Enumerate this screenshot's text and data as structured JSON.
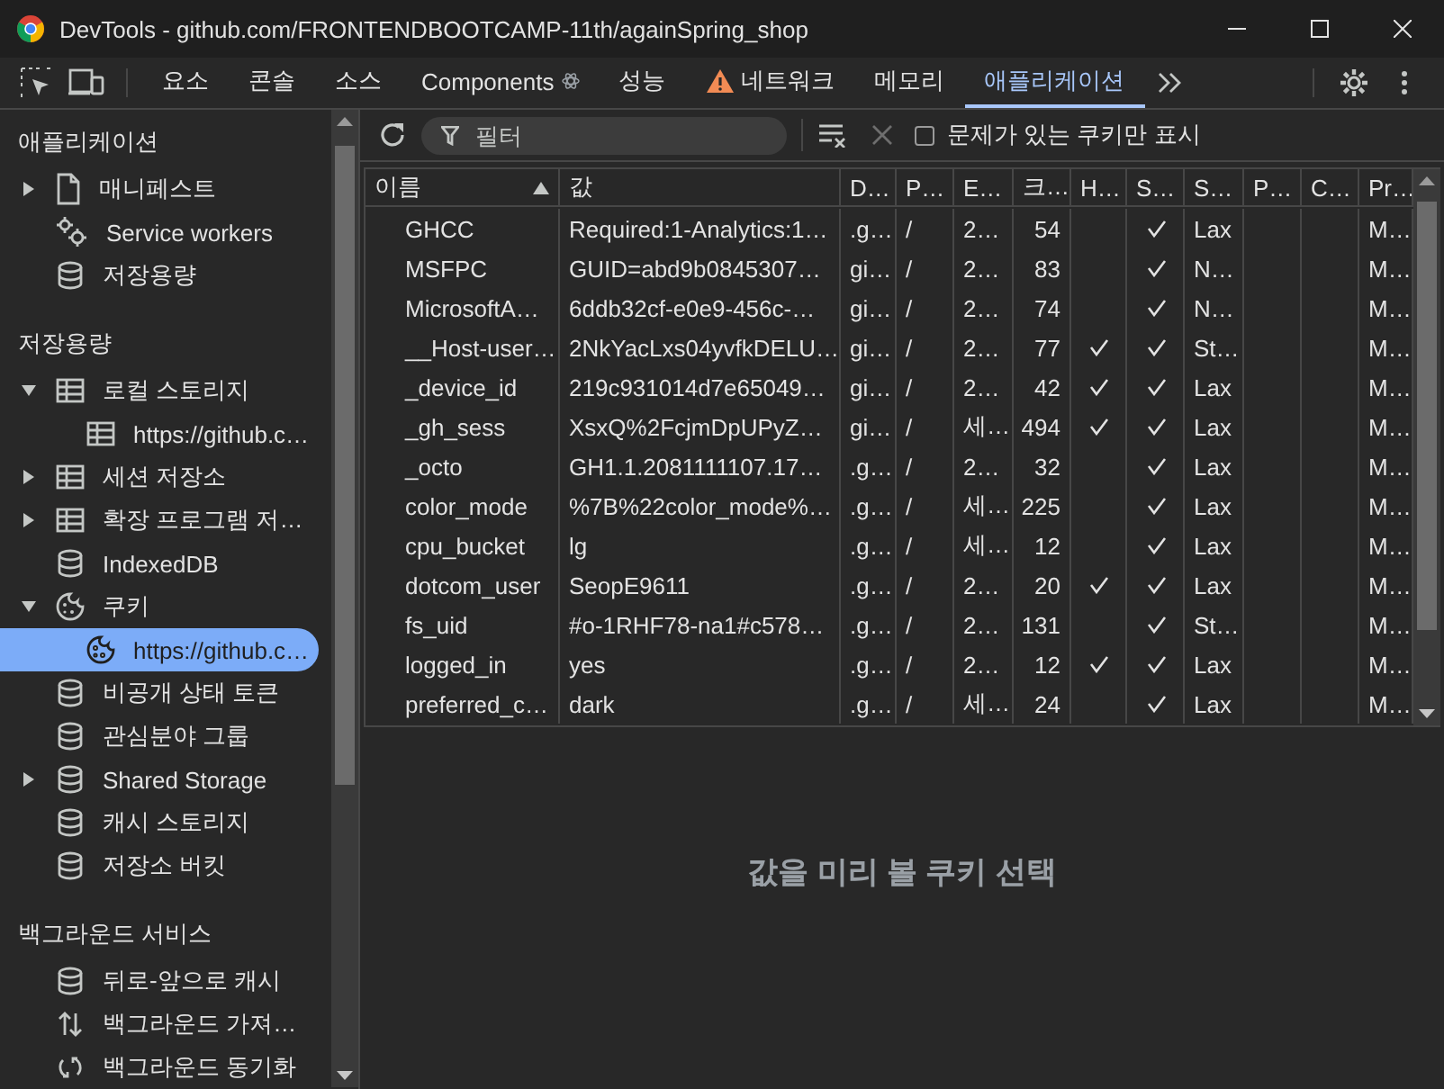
{
  "window": {
    "title": "DevTools - github.com/FRONTENDBOOTCAMP-11th/againSpring_shop"
  },
  "tabs": [
    {
      "label": "요소",
      "selected": false,
      "kind": "plain"
    },
    {
      "label": "콘솔",
      "selected": false,
      "kind": "plain"
    },
    {
      "label": "소스",
      "selected": false,
      "kind": "plain"
    },
    {
      "label": "Components",
      "selected": false,
      "kind": "extension"
    },
    {
      "label": "성능",
      "selected": false,
      "kind": "plain"
    },
    {
      "label": "네트워크",
      "selected": false,
      "kind": "warning"
    },
    {
      "label": "메모리",
      "selected": false,
      "kind": "plain"
    },
    {
      "label": "애플리케이션",
      "selected": true,
      "kind": "plain"
    }
  ],
  "sidebar": {
    "sections": [
      {
        "title": "애플리케이션",
        "items": [
          {
            "label": "매니페스트",
            "kind": "file",
            "expanded": false,
            "selected": false
          },
          {
            "label": "Service workers",
            "kind": "gears",
            "selected": false
          },
          {
            "label": "저장용량",
            "kind": "db",
            "selected": false
          }
        ]
      },
      {
        "title": "저장용량",
        "items": [
          {
            "label": "로컬 스토리지",
            "kind": "table",
            "expanded": true,
            "selected": false,
            "children": [
              {
                "label": "https://github.c…",
                "kind": "table",
                "selected": false
              }
            ]
          },
          {
            "label": "세션 저장소",
            "kind": "table",
            "expanded": false,
            "selected": false
          },
          {
            "label": "확장 프로그램 저…",
            "kind": "table",
            "expanded": false,
            "selected": false
          },
          {
            "label": "IndexedDB",
            "kind": "db",
            "selected": false
          },
          {
            "label": "쿠키",
            "kind": "cookie",
            "expanded": true,
            "selected": false,
            "children": [
              {
                "label": "https://github.c…",
                "kind": "cookie",
                "selected": true
              }
            ]
          },
          {
            "label": "비공개 상태 토큰",
            "kind": "db",
            "selected": false
          },
          {
            "label": "관심분야 그룹",
            "kind": "db",
            "selected": false
          },
          {
            "label": "Shared Storage",
            "kind": "db",
            "expanded": false,
            "selected": false
          },
          {
            "label": "캐시 스토리지",
            "kind": "db",
            "selected": false
          },
          {
            "label": "저장소 버킷",
            "kind": "db",
            "selected": false
          }
        ]
      },
      {
        "title": "백그라운드 서비스",
        "items": [
          {
            "label": "뒤로-앞으로 캐시",
            "kind": "db",
            "selected": false
          },
          {
            "label": "백그라운드 가져…",
            "kind": "arrows",
            "selected": false
          },
          {
            "label": "백그라운드 동기화",
            "kind": "sync",
            "selected": false
          }
        ]
      }
    ]
  },
  "toolbar": {
    "filter": {
      "placeholder": "필터"
    },
    "issues_only": {
      "label": "문제가 있는 쿠키만 표시",
      "checked": false
    }
  },
  "table": {
    "columns": [
      {
        "label": "이름",
        "sorted_ascending": true
      },
      {
        "label": "값"
      },
      {
        "label": "D…"
      },
      {
        "label": "P…"
      },
      {
        "label": "E…"
      },
      {
        "label": "크…"
      },
      {
        "label": "H…"
      },
      {
        "label": "S…"
      },
      {
        "label": "S…"
      },
      {
        "label": "P…"
      },
      {
        "label": "C…"
      },
      {
        "label": "Pr…"
      }
    ],
    "rows": [
      {
        "name": "GHCC",
        "value": "Required:1-Analytics:1…",
        "domain": ".g…",
        "path": "/",
        "expires": "2…",
        "size": "54",
        "http_only": false,
        "secure": true,
        "same_site": "Lax",
        "priority": "M…"
      },
      {
        "name": "MSFPC",
        "value": "GUID=abd9b0845307…",
        "domain": "gi…",
        "path": "/",
        "expires": "2…",
        "size": "83",
        "http_only": false,
        "secure": true,
        "same_site": "N…",
        "priority": "M…"
      },
      {
        "name": "MicrosoftA…",
        "value": "6ddb32cf-e0e9-456c-…",
        "domain": "gi…",
        "path": "/",
        "expires": "2…",
        "size": "74",
        "http_only": false,
        "secure": true,
        "same_site": "N…",
        "priority": "M…"
      },
      {
        "name": "__Host-user…",
        "value": "2NkYacLxs04yvfkDELU…",
        "domain": "gi…",
        "path": "/",
        "expires": "2…",
        "size": "77",
        "http_only": true,
        "secure": true,
        "same_site": "St…",
        "priority": "M…"
      },
      {
        "name": "_device_id",
        "value": "219c931014d7e65049…",
        "domain": "gi…",
        "path": "/",
        "expires": "2…",
        "size": "42",
        "http_only": true,
        "secure": true,
        "same_site": "Lax",
        "priority": "M…"
      },
      {
        "name": "_gh_sess",
        "value": "XsxQ%2FcjmDpUPyZ…",
        "domain": "gi…",
        "path": "/",
        "expires": "세…",
        "size": "494",
        "http_only": true,
        "secure": true,
        "same_site": "Lax",
        "priority": "M…"
      },
      {
        "name": "_octo",
        "value": "GH1.1.2081111107.17…",
        "domain": ".g…",
        "path": "/",
        "expires": "2…",
        "size": "32",
        "http_only": false,
        "secure": true,
        "same_site": "Lax",
        "priority": "M…"
      },
      {
        "name": "color_mode",
        "value": "%7B%22color_mode%…",
        "domain": ".g…",
        "path": "/",
        "expires": "세…",
        "size": "225",
        "http_only": false,
        "secure": true,
        "same_site": "Lax",
        "priority": "M…"
      },
      {
        "name": "cpu_bucket",
        "value": "lg",
        "domain": ".g…",
        "path": "/",
        "expires": "세…",
        "size": "12",
        "http_only": false,
        "secure": true,
        "same_site": "Lax",
        "priority": "M…"
      },
      {
        "name": "dotcom_user",
        "value": "SeopE9611",
        "domain": ".g…",
        "path": "/",
        "expires": "2…",
        "size": "20",
        "http_only": true,
        "secure": true,
        "same_site": "Lax",
        "priority": "M…"
      },
      {
        "name": "fs_uid",
        "value": "#o-1RHF78-na1#c578…",
        "domain": ".g…",
        "path": "/",
        "expires": "2…",
        "size": "131",
        "http_only": false,
        "secure": true,
        "same_site": "St…",
        "priority": "M…"
      },
      {
        "name": "logged_in",
        "value": "yes",
        "domain": ".g…",
        "path": "/",
        "expires": "2…",
        "size": "12",
        "http_only": true,
        "secure": true,
        "same_site": "Lax",
        "priority": "M…"
      },
      {
        "name": "preferred_c…",
        "value": "dark",
        "domain": ".g…",
        "path": "/",
        "expires": "세…",
        "size": "24",
        "http_only": false,
        "secure": true,
        "same_site": "Lax",
        "priority": "M…"
      }
    ]
  },
  "preview": {
    "message": "값을 미리 볼 쿠키 선택"
  }
}
